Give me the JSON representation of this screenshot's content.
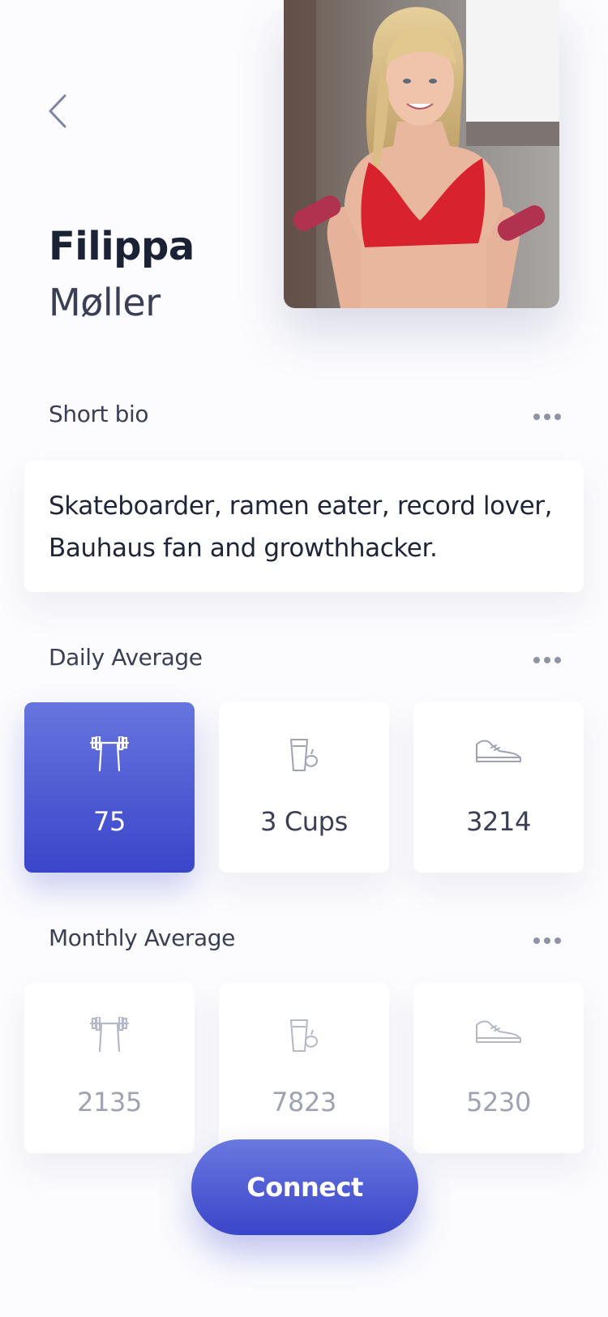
{
  "profile": {
    "first_name": "Filippa",
    "last_name": "Møller"
  },
  "bio": {
    "title": "Short bio",
    "text": "Skateboarder, ramen eater, record lover, Bauhaus fan and growthhacker."
  },
  "daily": {
    "title": "Daily Average",
    "stats": [
      {
        "icon": "barbell-icon",
        "value": "75",
        "active": true
      },
      {
        "icon": "drink-cup-icon",
        "value": "3 Cups"
      },
      {
        "icon": "sneaker-icon",
        "value": "3214"
      }
    ]
  },
  "monthly": {
    "title": "Monthly Average",
    "stats": [
      {
        "icon": "barbell-icon",
        "value": "2135"
      },
      {
        "icon": "drink-cup-icon",
        "value": "7823"
      },
      {
        "icon": "sneaker-icon",
        "value": "5230"
      }
    ]
  },
  "actions": {
    "connect_label": "Connect",
    "back_icon": "chevron-left-icon",
    "more_icon": "more-dots-icon"
  },
  "colors": {
    "accent_top": "#6775df",
    "accent_bottom": "#3a45c9",
    "text_dark": "#1f2538",
    "muted": "#9ea2b3"
  }
}
